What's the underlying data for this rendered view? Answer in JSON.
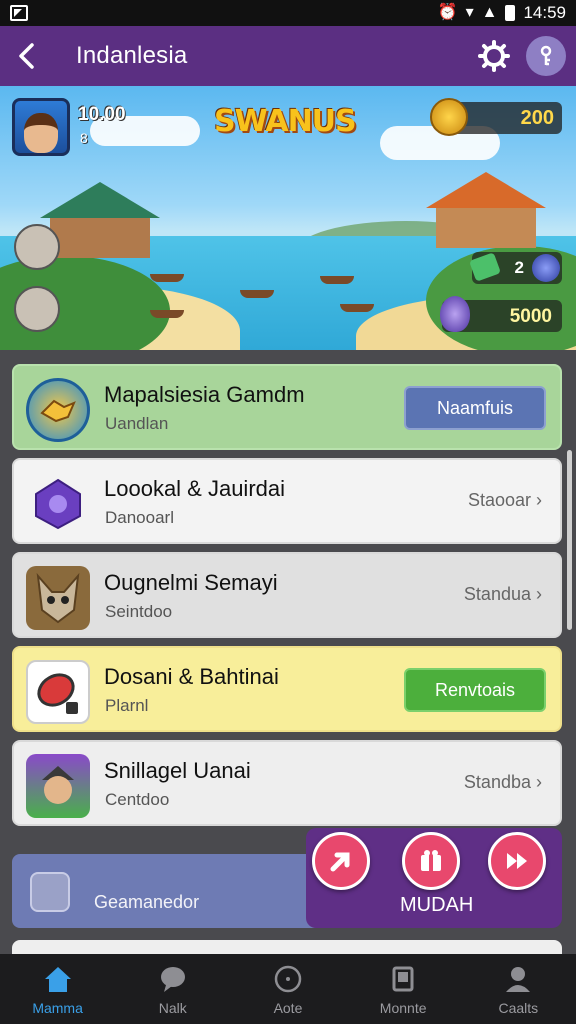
{
  "status_bar": {
    "time": "14:59"
  },
  "header": {
    "title": "Indanlesia"
  },
  "hero": {
    "logo_text": "SWANUS",
    "player_score": "10.00",
    "player_sub": "8",
    "coins": "200",
    "gems_green": "2",
    "gems_purple": "5000"
  },
  "list": [
    {
      "title": "Mapalsiesia Gamdm",
      "subtitle": "Uandlan",
      "action": "Naamfuis",
      "action_type": "button",
      "bg": "#a8d59a",
      "btn_color": "#5b74b3"
    },
    {
      "title": "Loookal & Jauirdai",
      "subtitle": "Danooarl",
      "action": "Staooar",
      "action_type": "link",
      "bg": "#f3f3f3"
    },
    {
      "title": "Ougnelmi Semayi",
      "subtitle": "Seintdoo",
      "action": "Standua",
      "action_type": "link",
      "bg": "#e0e0e0"
    },
    {
      "title": "Dosani & Bahtinai",
      "subtitle": "Plarnl",
      "action": "Renvtoais",
      "action_type": "button",
      "bg": "#f8ee9a",
      "btn_color": "#4caf3c"
    },
    {
      "title": "Snillagel Uanai",
      "subtitle": "Centdoo",
      "action": "Standba",
      "action_type": "link",
      "bg": "#eeeeee"
    }
  ],
  "bottom_card": {
    "label": "Geamanedor"
  },
  "fab_panel": {
    "label": "MUDAH"
  },
  "nav": [
    {
      "label": "Mamma",
      "icon": "home-icon"
    },
    {
      "label": "Nalk",
      "icon": "chat-icon"
    },
    {
      "label": "Aote",
      "icon": "circle-icon"
    },
    {
      "label": "Monnte",
      "icon": "trophy-icon"
    },
    {
      "label": "Caalts",
      "icon": "person-icon"
    }
  ],
  "colors": {
    "accent": "#5b2f82",
    "nav_active": "#3aa0e8",
    "fab": "#e8486d"
  }
}
